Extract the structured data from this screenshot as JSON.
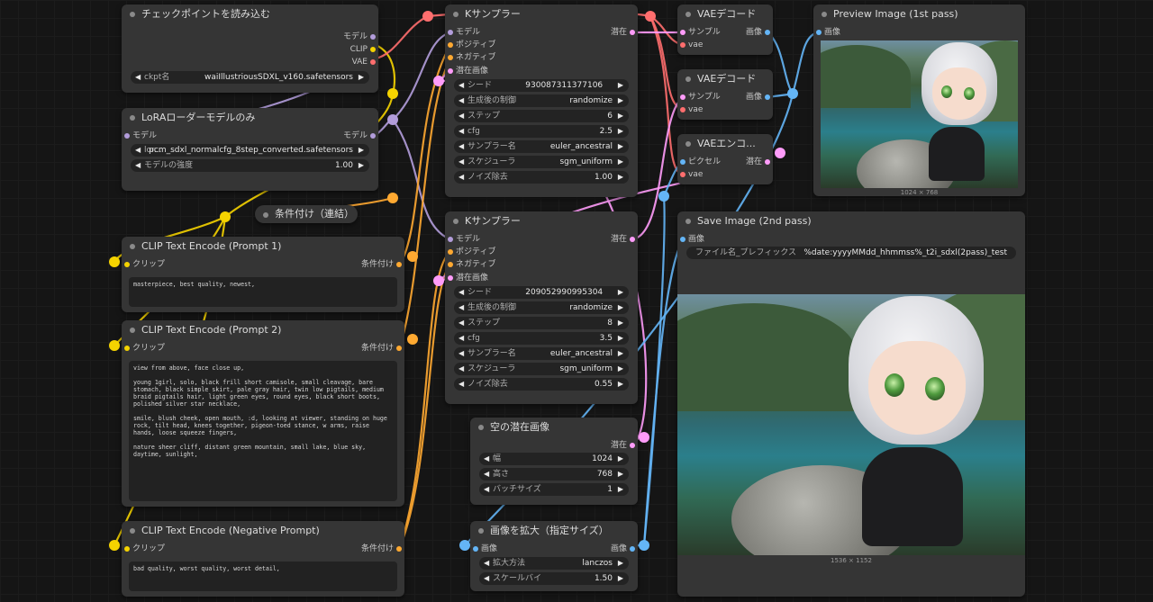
{
  "colors": {
    "model": "#b39ddb",
    "clip": "#f5d300",
    "vae": "#ff6e6e",
    "conditioning": "#ffa931",
    "latent": "#ff9cf9",
    "image": "#64b5f6",
    "socket_gray": "#888888"
  },
  "nodes": {
    "checkpoint": {
      "title": "チェックポイントを読み込む",
      "outputs": [
        "モデル",
        "CLIP",
        "VAE"
      ],
      "widget": {
        "label": "ckpt名",
        "value": "waiIllustriousSDXL_v160.safetensors"
      }
    },
    "lora": {
      "title": "LoRAローダーモデルのみ",
      "input": "モデル",
      "output": "モデル",
      "widget1": {
        "label": "lor...",
        "value": "pcm_sdxl_normalcfg_8step_converted.safetensors"
      },
      "widget2": {
        "label": "モデルの強度",
        "value": "1.00"
      }
    },
    "concat": {
      "title": "条件付け（連結）"
    },
    "clip1": {
      "title": "CLIP Text Encode (Prompt 1)",
      "input": "クリップ",
      "output": "条件付け",
      "text": "masterpiece, best quality, newest,"
    },
    "clip2": {
      "title": "CLIP Text Encode (Prompt 2)",
      "input": "クリップ",
      "output": "条件付け",
      "text": "view from above, face close up,\n\nyoung 1girl, solo, black frill short camisole, small cleavage, bare stomach, black simple skirt, pale gray hair, twin low pigtails, medium braid pigtails hair, light green eyes, round eyes, black short boots, polished silver star necklace,\n\nsmile, blush cheek, open mouth, :d, looking at viewer, standing on huge rock, tilt head, knees together, pigeon-toed stance, w arms, raise hands, loose squeeze fingers,\n\nnature sheer cliff, distant green mountain, small lake, blue sky, daytime, sunlight,"
    },
    "clipneg": {
      "title": "CLIP Text Encode (Negative Prompt)",
      "input": "クリップ",
      "output": "条件付け",
      "text": "bad quality, worst quality, worst detail,"
    },
    "ksampler1": {
      "title": "Kサンプラー",
      "inputs": [
        "モデル",
        "ポジティブ",
        "ネガティブ",
        "潜在画像"
      ],
      "output": "潜在",
      "widgets": [
        {
          "label": "シード",
          "value": "930087311377106",
          "center": true
        },
        {
          "label": "生成後の制御",
          "value": "randomize"
        },
        {
          "label": "ステップ",
          "value": "6"
        },
        {
          "label": "cfg",
          "value": "2.5"
        },
        {
          "label": "サンプラー名",
          "value": "euler_ancestral"
        },
        {
          "label": "スケジューラ",
          "value": "sgm_uniform"
        },
        {
          "label": "ノイズ除去",
          "value": "1.00"
        }
      ]
    },
    "ksampler2": {
      "title": "Kサンプラー",
      "inputs": [
        "モデル",
        "ポジティブ",
        "ネガティブ",
        "潜在画像"
      ],
      "output": "潜在",
      "widgets": [
        {
          "label": "シード",
          "value": "209052990995304",
          "center": true
        },
        {
          "label": "生成後の制御",
          "value": "randomize"
        },
        {
          "label": "ステップ",
          "value": "8"
        },
        {
          "label": "cfg",
          "value": "3.5"
        },
        {
          "label": "サンプラー名",
          "value": "euler_ancestral"
        },
        {
          "label": "スケジューラ",
          "value": "sgm_uniform"
        },
        {
          "label": "ノイズ除去",
          "value": "0.55"
        }
      ]
    },
    "empty_latent": {
      "title": "空の潜在画像",
      "output": "潜在",
      "widgets": [
        {
          "label": "幅",
          "value": "1024"
        },
        {
          "label": "高さ",
          "value": "768"
        },
        {
          "label": "バッチサイズ",
          "value": "1"
        }
      ]
    },
    "upscale": {
      "title": "画像を拡大（指定サイズ）",
      "input": "画像",
      "output": "画像",
      "widgets": [
        {
          "label": "拡大方法",
          "value": "lanczos"
        },
        {
          "label": "スケールバイ",
          "value": "1.50"
        }
      ]
    },
    "vaedecode1": {
      "title": "VAEデコード",
      "inputs": [
        "サンプル",
        "vae"
      ],
      "output": "画像"
    },
    "vaedecode2": {
      "title": "VAEデコード",
      "inputs": [
        "サンプル",
        "vae"
      ],
      "output": "画像"
    },
    "vaeencode": {
      "title": "VAEエンコ...",
      "inputs": [
        "ピクセル",
        "vae"
      ],
      "output": "潜在"
    },
    "preview": {
      "title": "Preview Image (1st pass)",
      "input": "画像",
      "caption": "1024 × 768"
    },
    "save": {
      "title": "Save Image (2nd pass)",
      "input": "画像",
      "widget": {
        "label": "ファイル名_プレフィックス",
        "value": "%date:yyyyMMdd_hhmmss%_t2i_sdxl(2pass)_test"
      },
      "caption": "1536 × 1152"
    }
  }
}
